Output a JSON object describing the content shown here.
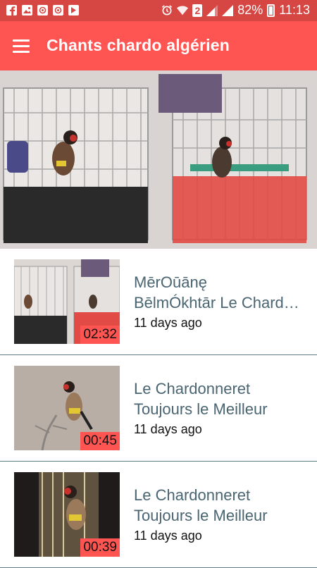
{
  "status_bar": {
    "battery": "82%",
    "time": "11:13",
    "sim_badge": "2",
    "left_icons": [
      "facebook-icon",
      "gallery-icon",
      "at-mail-icon",
      "at-mail-icon",
      "download-icon"
    ],
    "right_icons": [
      "alarm-icon",
      "wifi-icon",
      "signal-icon",
      "battery-icon"
    ]
  },
  "app_bar": {
    "title": "Chants chardo algérien",
    "menu_icon": "hamburger-menu-icon"
  },
  "colors": {
    "primary": "#ff5552",
    "status_bar": "#d64744",
    "title_text": "#4a6572",
    "divider": "#607c86"
  },
  "videos": [
    {
      "title_line1": "MērOūānę",
      "title_line2": "BēlmÓkhtār  Le Chardonneret",
      "date": "11 days ago",
      "duration": "02:32"
    },
    {
      "title_line1": "Le Chardonneret",
      "title_line2": "Toujours le Meilleur",
      "date": "11 days ago",
      "duration": "00:45"
    },
    {
      "title_line1": "Le Chardonneret",
      "title_line2": "Toujours le Meilleur",
      "date": "11 days ago",
      "duration": "00:39"
    }
  ]
}
